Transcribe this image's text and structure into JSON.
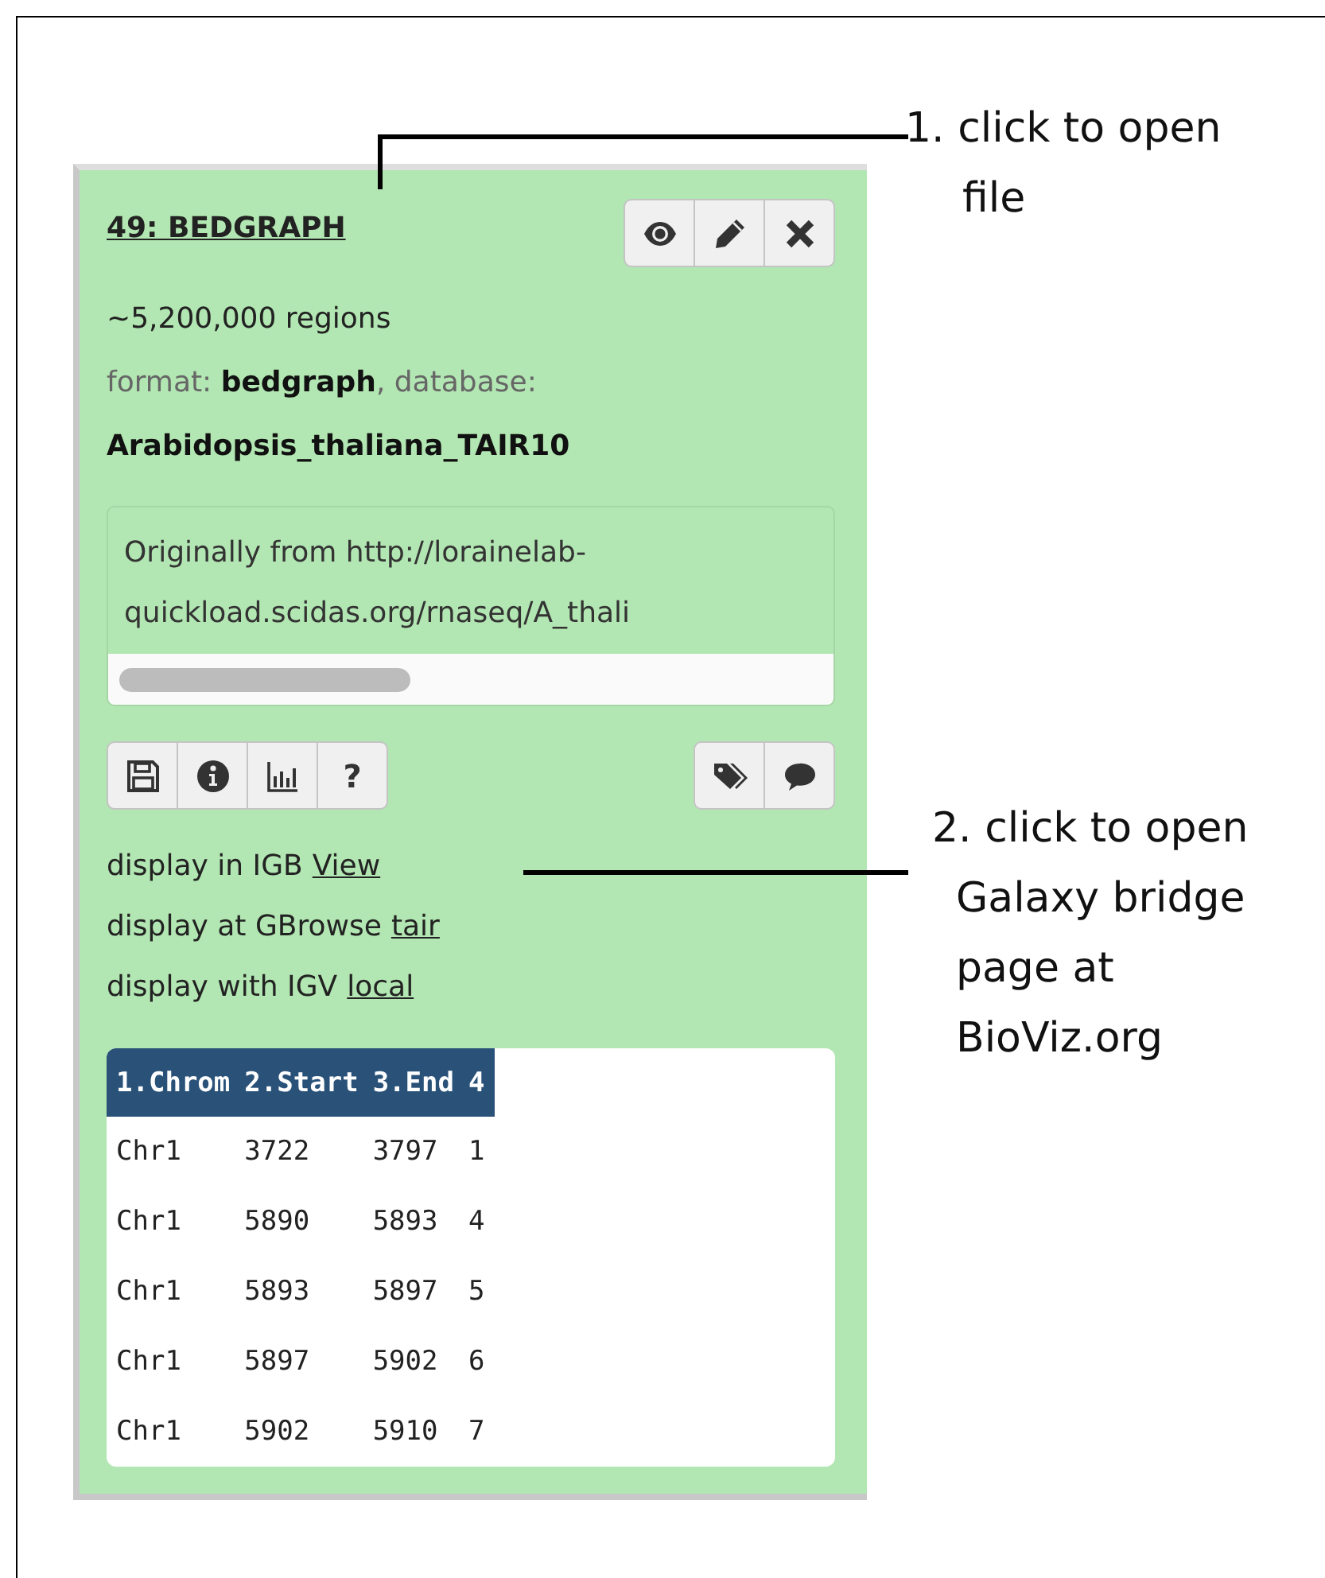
{
  "dataset": {
    "title": "49: BEDGRAPH",
    "actions": [
      {
        "kind": "view"
      },
      {
        "kind": "edit"
      },
      {
        "kind": "delete"
      }
    ],
    "summary": "~5,200,000 regions",
    "info": "format: **bedgraph**, database: **Arabidopsis_thaliana_TAIR10**",
    "peek_text": "Originally from http://lorainelab-quickload.scidas.org/rnaseq/A_thali",
    "tools_left": [
      {
        "kind": "save"
      },
      {
        "kind": "info"
      },
      {
        "kind": "chart"
      },
      {
        "kind": "help",
        "label": "?"
      }
    ],
    "tools_right": [
      {
        "kind": "tags"
      },
      {
        "kind": "comment"
      }
    ],
    "displays": [
      {
        "text": "display in IGB",
        "link": "View"
      },
      {
        "text": "display at GBrowse",
        "link": "tair"
      },
      {
        "text": "display with IGV",
        "link": "local"
      }
    ],
    "table": {
      "columns": [
        "1.Chrom",
        "2.Start",
        "3.End",
        "4"
      ],
      "rows": [
        [
          "Chr1",
          "3722",
          "3797",
          "1"
        ],
        [
          "Chr1",
          "5890",
          "5893",
          "4"
        ],
        [
          "Chr1",
          "5893",
          "5897",
          "5"
        ],
        [
          "Chr1",
          "5897",
          "5902",
          "6"
        ],
        [
          "Chr1",
          "5902",
          "5910",
          "7"
        ]
      ]
    }
  },
  "annotations": [
    {
      "text": "1. click to open file"
    },
    {
      "text": "2. click to open Galaxy bridge page at BioViz.org"
    }
  ]
}
